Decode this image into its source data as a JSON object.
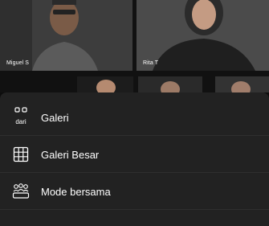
{
  "participants": [
    {
      "name": "Miguel S"
    },
    {
      "name": "Rita T"
    }
  ],
  "menu": {
    "items": [
      {
        "label": "Galeri",
        "icon": "gallery-icon",
        "icon_caption": "dari"
      },
      {
        "label": "Galeri Besar",
        "icon": "large-gallery-icon"
      },
      {
        "label": "Mode bersama",
        "icon": "together-mode-icon"
      }
    ]
  },
  "colors": {
    "sheet_background": "#222222",
    "text": "#ffffff",
    "background": "#0d0d0d"
  }
}
